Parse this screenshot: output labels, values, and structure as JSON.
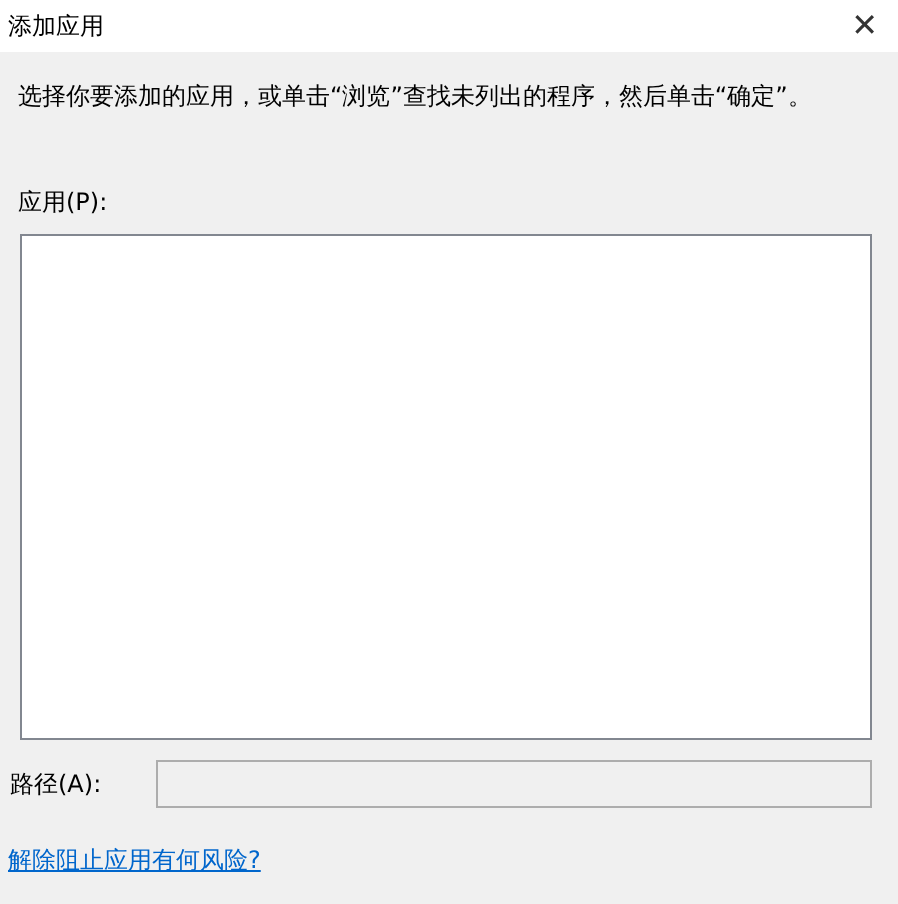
{
  "window": {
    "title": "添加应用",
    "close": "✕"
  },
  "instruction": "选择你要添加的应用，或单击“浏览”查找未列出的程序，然后单击“确定”。",
  "apps_label": "应用(P):",
  "path_label": "路径(A):",
  "path_field": {
    "disabled": true
  },
  "risk_link": "解除阻止应用有何风险?"
}
